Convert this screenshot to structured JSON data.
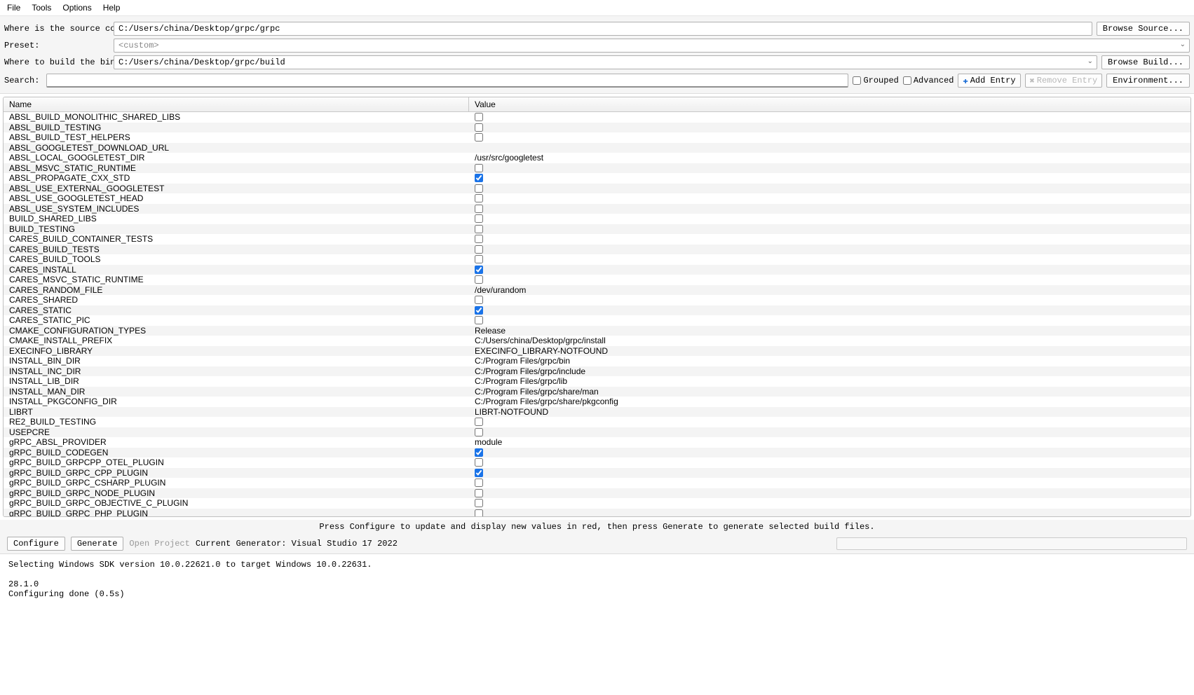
{
  "menu": {
    "file": "File",
    "tools": "Tools",
    "options": "Options",
    "help": "Help"
  },
  "labels": {
    "source": "Where is the source code:",
    "preset": "Preset:",
    "build": "Where to build the binaries:",
    "search": "Search:"
  },
  "paths": {
    "source": "C:/Users/china/Desktop/grpc/grpc",
    "preset": "<custom>",
    "build": "C:/Users/china/Desktop/grpc/build"
  },
  "buttons": {
    "browse_source": "Browse Source...",
    "browse_build": "Browse Build...",
    "grouped": "Grouped",
    "advanced": "Advanced",
    "add_entry": "Add Entry",
    "remove_entry": "Remove Entry",
    "environment": "Environment...",
    "configure": "Configure",
    "generate": "Generate",
    "open_project": "Open Project"
  },
  "headers": {
    "name": "Name",
    "value": "Value"
  },
  "entries": [
    {
      "name": "ABSL_BUILD_MONOLITHIC_SHARED_LIBS",
      "type": "bool",
      "checked": false
    },
    {
      "name": "ABSL_BUILD_TESTING",
      "type": "bool",
      "checked": false
    },
    {
      "name": "ABSL_BUILD_TEST_HELPERS",
      "type": "bool",
      "checked": false
    },
    {
      "name": "ABSL_GOOGLETEST_DOWNLOAD_URL",
      "type": "text",
      "value": ""
    },
    {
      "name": "ABSL_LOCAL_GOOGLETEST_DIR",
      "type": "text",
      "value": "/usr/src/googletest"
    },
    {
      "name": "ABSL_MSVC_STATIC_RUNTIME",
      "type": "bool",
      "checked": false
    },
    {
      "name": "ABSL_PROPAGATE_CXX_STD",
      "type": "bool",
      "checked": true
    },
    {
      "name": "ABSL_USE_EXTERNAL_GOOGLETEST",
      "type": "bool",
      "checked": false
    },
    {
      "name": "ABSL_USE_GOOGLETEST_HEAD",
      "type": "bool",
      "checked": false
    },
    {
      "name": "ABSL_USE_SYSTEM_INCLUDES",
      "type": "bool",
      "checked": false
    },
    {
      "name": "BUILD_SHARED_LIBS",
      "type": "bool",
      "checked": false
    },
    {
      "name": "BUILD_TESTING",
      "type": "bool",
      "checked": false
    },
    {
      "name": "CARES_BUILD_CONTAINER_TESTS",
      "type": "bool",
      "checked": false
    },
    {
      "name": "CARES_BUILD_TESTS",
      "type": "bool",
      "checked": false
    },
    {
      "name": "CARES_BUILD_TOOLS",
      "type": "bool",
      "checked": false
    },
    {
      "name": "CARES_INSTALL",
      "type": "bool",
      "checked": true
    },
    {
      "name": "CARES_MSVC_STATIC_RUNTIME",
      "type": "bool",
      "checked": false
    },
    {
      "name": "CARES_RANDOM_FILE",
      "type": "text",
      "value": "/dev/urandom"
    },
    {
      "name": "CARES_SHARED",
      "type": "bool",
      "checked": false
    },
    {
      "name": "CARES_STATIC",
      "type": "bool",
      "checked": true
    },
    {
      "name": "CARES_STATIC_PIC",
      "type": "bool",
      "checked": false
    },
    {
      "name": "CMAKE_CONFIGURATION_TYPES",
      "type": "text",
      "value": "Release"
    },
    {
      "name": "CMAKE_INSTALL_PREFIX",
      "type": "text",
      "value": "C:/Users/china/Desktop/grpc/install"
    },
    {
      "name": "EXECINFO_LIBRARY",
      "type": "text",
      "value": "EXECINFO_LIBRARY-NOTFOUND"
    },
    {
      "name": "INSTALL_BIN_DIR",
      "type": "text",
      "value": "C:/Program Files/grpc/bin"
    },
    {
      "name": "INSTALL_INC_DIR",
      "type": "text",
      "value": "C:/Program Files/grpc/include"
    },
    {
      "name": "INSTALL_LIB_DIR",
      "type": "text",
      "value": "C:/Program Files/grpc/lib"
    },
    {
      "name": "INSTALL_MAN_DIR",
      "type": "text",
      "value": "C:/Program Files/grpc/share/man"
    },
    {
      "name": "INSTALL_PKGCONFIG_DIR",
      "type": "text",
      "value": "C:/Program Files/grpc/share/pkgconfig"
    },
    {
      "name": "LIBRT",
      "type": "text",
      "value": "LIBRT-NOTFOUND"
    },
    {
      "name": "RE2_BUILD_TESTING",
      "type": "bool",
      "checked": false
    },
    {
      "name": "USEPCRE",
      "type": "bool",
      "checked": false
    },
    {
      "name": "gRPC_ABSL_PROVIDER",
      "type": "text",
      "value": "module"
    },
    {
      "name": "gRPC_BUILD_CODEGEN",
      "type": "bool",
      "checked": true
    },
    {
      "name": "gRPC_BUILD_GRPCPP_OTEL_PLUGIN",
      "type": "bool",
      "checked": false
    },
    {
      "name": "gRPC_BUILD_GRPC_CPP_PLUGIN",
      "type": "bool",
      "checked": true
    },
    {
      "name": "gRPC_BUILD_GRPC_CSHARP_PLUGIN",
      "type": "bool",
      "checked": false
    },
    {
      "name": "gRPC_BUILD_GRPC_NODE_PLUGIN",
      "type": "bool",
      "checked": false
    },
    {
      "name": "gRPC_BUILD_GRPC_OBJECTIVE_C_PLUGIN",
      "type": "bool",
      "checked": false
    },
    {
      "name": "gRPC_BUILD_GRPC_PHP_PLUGIN",
      "type": "bool",
      "checked": false
    }
  ],
  "hint": "Press Configure to update and display new values in red, then press Generate to generate selected build files.",
  "generator": "Current Generator: Visual Studio 17 2022",
  "log": "Selecting Windows SDK version 10.0.22621.0 to target Windows 10.0.22631.\n\n28.1.0\nConfiguring done (0.5s)"
}
